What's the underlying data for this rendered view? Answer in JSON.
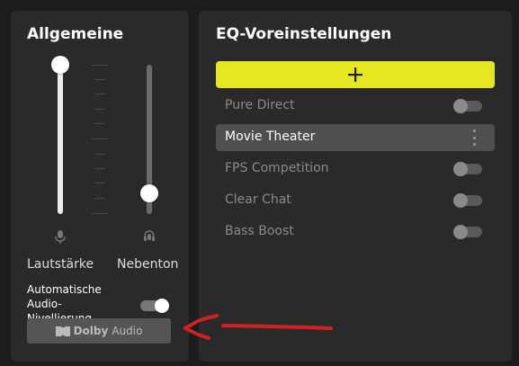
{
  "general": {
    "title": "Allgemeine",
    "volume": {
      "label": "Lautstärke",
      "icon": "microphone-icon",
      "level": 1.0
    },
    "sidetone": {
      "label": "Nebenton",
      "icon": "headset-mic-icon",
      "level": 0.0
    },
    "auto_label": "Automatische Audio-Nivellierung",
    "auto_toggle_on": true,
    "dolby": {
      "brand": "Dolby",
      "suffix": "Audio",
      "icon": "dolby-logo-icon"
    }
  },
  "eq": {
    "title": "EQ-Voreinstellungen",
    "add_icon": "plus-icon",
    "presets": [
      {
        "label": "Pure Direct",
        "selected": false,
        "enabled": false
      },
      {
        "label": "Movie Theater",
        "selected": true,
        "enabled": true
      },
      {
        "label": "FPS Competition",
        "selected": false,
        "enabled": false
      },
      {
        "label": "Clear Chat",
        "selected": false,
        "enabled": false
      },
      {
        "label": "Bass Boost",
        "selected": false,
        "enabled": false
      }
    ]
  },
  "annotation": {
    "color": "#d42020",
    "type": "arrow-pointing-left"
  },
  "colors": {
    "accent": "#e6e622",
    "panel": "#2a2a2a",
    "background": "#1c1c1c"
  }
}
